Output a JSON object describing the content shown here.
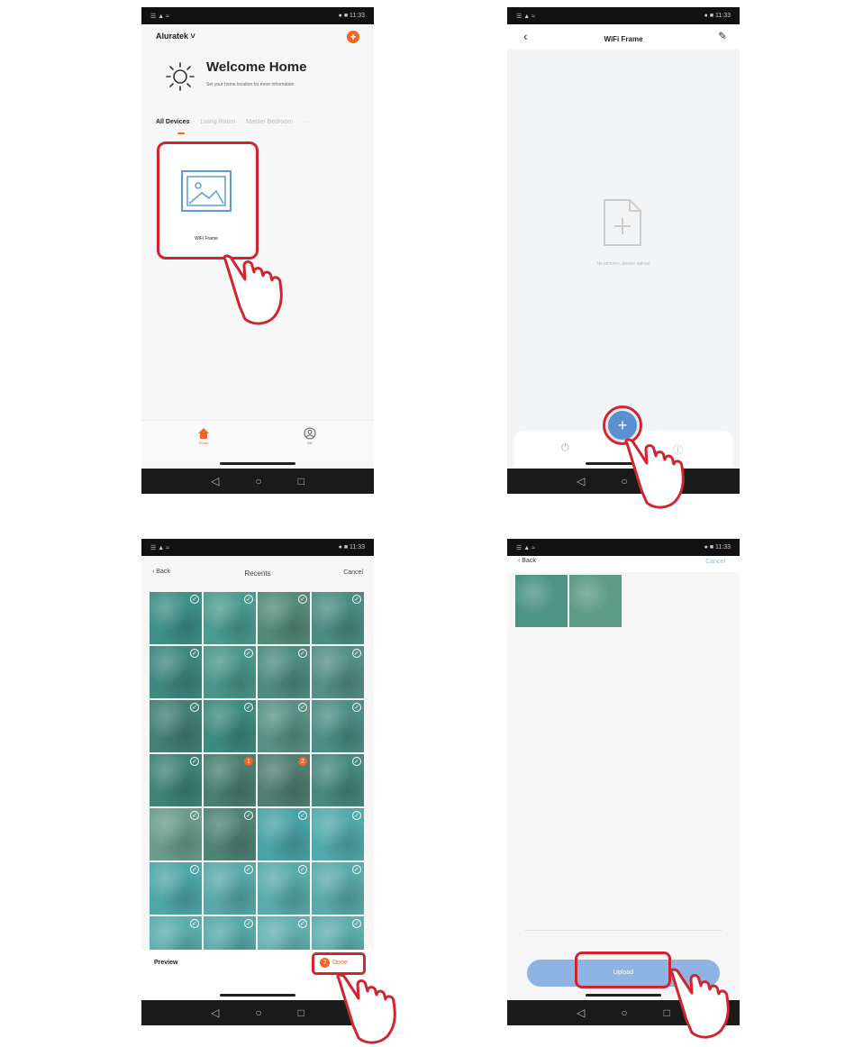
{
  "status": {
    "left": "☰ ▲ ≈",
    "right": "● ■ 11:33"
  },
  "screen1": {
    "location": "Aluratek ˅",
    "add_symbol": "+",
    "welcome_title": "Welcome Home",
    "welcome_sub": "Set your home location for more information",
    "tabs": [
      "All Devices",
      "Living Room",
      "Master Bedroom",
      "···"
    ],
    "device_label": "WiFi Frame",
    "tab_home": "Home",
    "tab_me": "Me"
  },
  "screen2": {
    "back": "‹",
    "title": "WiFi Frame",
    "edit": "✎",
    "empty_text": "No pictures, please upload",
    "power": "⏻",
    "info": "ⓘ",
    "fab": "+"
  },
  "screen3": {
    "back": "‹ Back",
    "title": "Recents",
    "cancel": "Cancel",
    "preview": "Preview",
    "done_count": "2",
    "done": "Done",
    "checkmark": "✓",
    "photo_tones": [
      "#3e8f86",
      "#4a9b8f",
      "#568a78",
      "#4b8d84",
      "#3f887f",
      "#4a968b",
      "#4f8c7f",
      "#548f85",
      "#437f76",
      "#3d8a7f",
      "#5a9184",
      "#4c8e86",
      "#3f8378",
      "#4a7f70",
      "#517e71",
      "#47897d",
      "#6a9c8b",
      "#4f8377",
      "#4aa3a6",
      "#52a9ab",
      "#4fa7a8",
      "#59a9aa",
      "#5aabab",
      "#5aaaa9",
      "#5bacac",
      "#58a8a8",
      "#63b0ae",
      "#5faeac"
    ],
    "selected": [
      13,
      14
    ]
  },
  "screen4": {
    "back": "‹ Back",
    "cancel": "Cancel",
    "upload": "Upload",
    "thumb_tones": [
      "#4e9483",
      "#5e9b86"
    ]
  },
  "navbar": {
    "back": "◁",
    "home": "○",
    "recents": "□"
  }
}
